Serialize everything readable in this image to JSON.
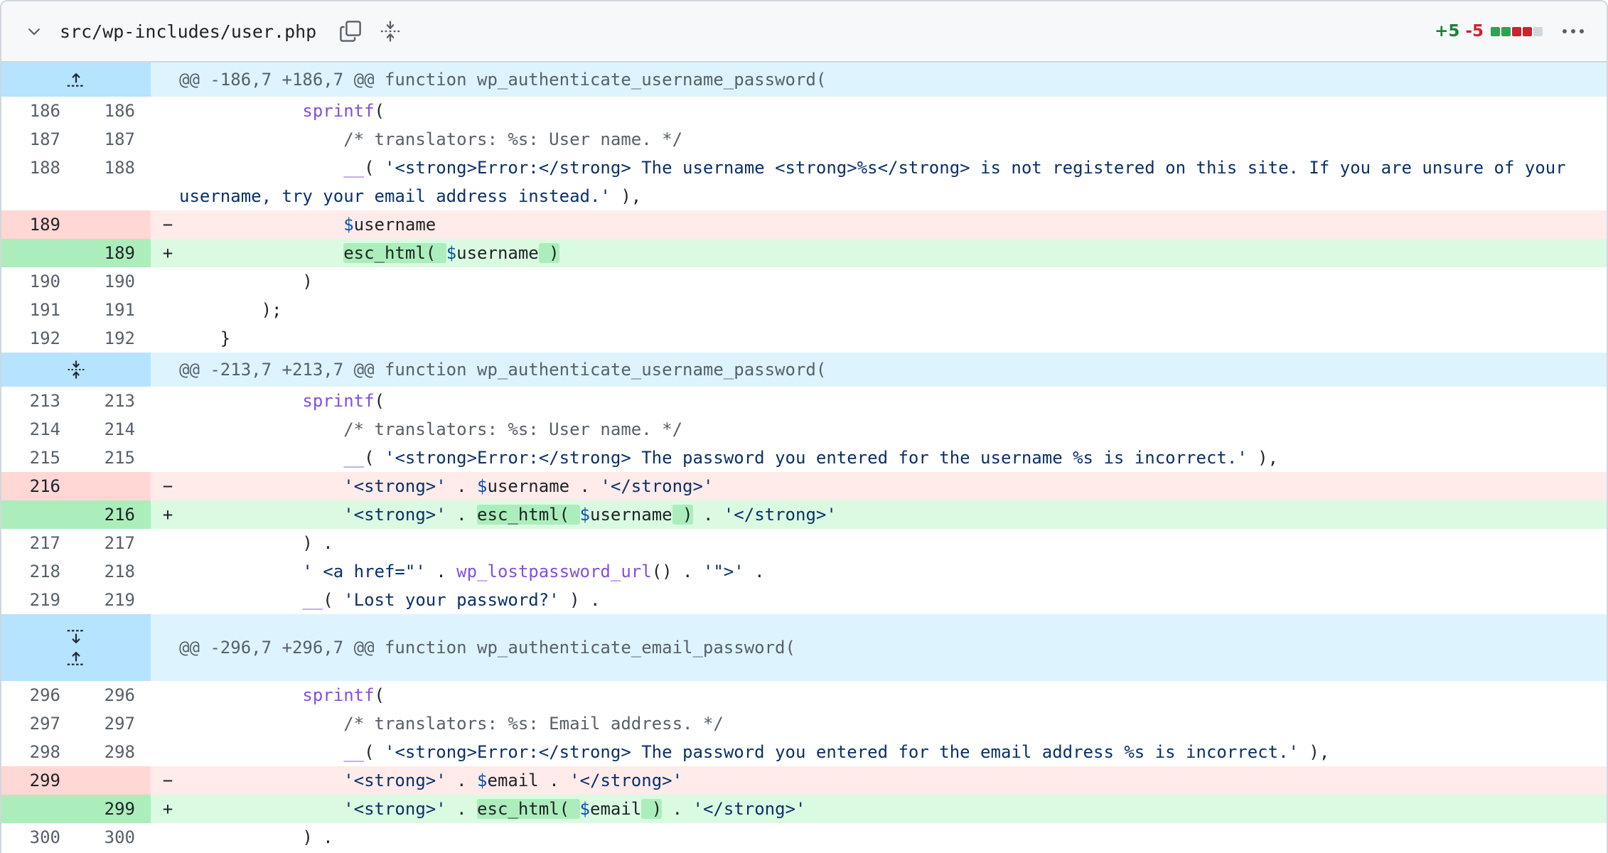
{
  "file": {
    "path": "src/wp-includes/user.php",
    "additions": "+5",
    "deletions": "-5",
    "stat_blocks": [
      "green",
      "green",
      "red",
      "red",
      "neutral"
    ],
    "icons": {
      "collapse": "chevron-down-icon",
      "copy": "copy-icon",
      "expand_all": "unfold-icon",
      "more": "kebab-horizontal-icon"
    },
    "colors": {
      "addition": "#1a7f37",
      "deletion": "#cf222e",
      "hunk_bg": "#ddf4ff",
      "hunk_gutter": "#b6e3ff",
      "add_bg": "#dafbe1",
      "add_num_bg": "#aceebb",
      "del_bg": "#ffebe9",
      "del_num_bg": "#ffd7d5"
    }
  },
  "hunks": [
    {
      "header": "@@ -186,7 +186,7 @@ function wp_authenticate_username_password(",
      "expanders": [
        "expand-up"
      ],
      "lines": [
        {
          "type": "ctx",
          "old": "186",
          "new": "186",
          "tokens": [
            {
              "t": "            ",
              "c": ""
            },
            {
              "t": "sprintf",
              "c": "fn"
            },
            {
              "t": "(",
              "c": ""
            }
          ]
        },
        {
          "type": "ctx",
          "old": "187",
          "new": "187",
          "tokens": [
            {
              "t": "                ",
              "c": ""
            },
            {
              "t": "/* translators: %s: User name. */",
              "c": "cm"
            }
          ]
        },
        {
          "type": "ctx",
          "old": "188",
          "new": "188",
          "tokens": [
            {
              "t": "                ",
              "c": ""
            },
            {
              "t": "__",
              "c": "fn"
            },
            {
              "t": "( ",
              "c": ""
            },
            {
              "t": "'<strong>Error:</strong> The username <strong>%s</strong> is not registered on this site. If you are unsure of your username, try your email address instead.'",
              "c": "st"
            },
            {
              "t": " ),",
              "c": ""
            }
          ]
        },
        {
          "type": "del",
          "old": "189",
          "new": "",
          "sign": "−",
          "tokens": [
            {
              "t": "                ",
              "c": ""
            },
            {
              "t": "$",
              "c": "vr"
            },
            {
              "t": "username",
              "c": ""
            }
          ]
        },
        {
          "type": "add",
          "old": "",
          "new": "189",
          "sign": "+",
          "tokens": [
            {
              "t": "                ",
              "c": ""
            },
            {
              "t": "esc_html( ",
              "c": "hl"
            },
            {
              "t": "$",
              "c": "vr"
            },
            {
              "t": "username",
              "c": ""
            },
            {
              "t": " )",
              "c": "hl"
            }
          ]
        },
        {
          "type": "ctx",
          "old": "190",
          "new": "190",
          "tokens": [
            {
              "t": "            )",
              "c": ""
            }
          ]
        },
        {
          "type": "ctx",
          "old": "191",
          "new": "191",
          "tokens": [
            {
              "t": "        );",
              "c": ""
            }
          ]
        },
        {
          "type": "ctx",
          "old": "192",
          "new": "192",
          "tokens": [
            {
              "t": "    }",
              "c": ""
            }
          ]
        }
      ]
    },
    {
      "header": "@@ -213,7 +213,7 @@ function wp_authenticate_username_password(",
      "expanders": [
        "expand-both"
      ],
      "lines": [
        {
          "type": "ctx",
          "old": "213",
          "new": "213",
          "tokens": [
            {
              "t": "            ",
              "c": ""
            },
            {
              "t": "sprintf",
              "c": "fn"
            },
            {
              "t": "(",
              "c": ""
            }
          ]
        },
        {
          "type": "ctx",
          "old": "214",
          "new": "214",
          "tokens": [
            {
              "t": "                ",
              "c": ""
            },
            {
              "t": "/* translators: %s: User name. */",
              "c": "cm"
            }
          ]
        },
        {
          "type": "ctx",
          "old": "215",
          "new": "215",
          "tokens": [
            {
              "t": "                ",
              "c": ""
            },
            {
              "t": "__",
              "c": "fn"
            },
            {
              "t": "( ",
              "c": ""
            },
            {
              "t": "'<strong>Error:</strong> The password you entered for the username %s is incorrect.'",
              "c": "st"
            },
            {
              "t": " ),",
              "c": ""
            }
          ]
        },
        {
          "type": "del",
          "old": "216",
          "new": "",
          "sign": "−",
          "tokens": [
            {
              "t": "                ",
              "c": ""
            },
            {
              "t": "'<strong>'",
              "c": "st"
            },
            {
              "t": " . ",
              "c": ""
            },
            {
              "t": "$",
              "c": "vr"
            },
            {
              "t": "username",
              "c": ""
            },
            {
              "t": " . ",
              "c": ""
            },
            {
              "t": "'</strong>'",
              "c": "st"
            }
          ]
        },
        {
          "type": "add",
          "old": "",
          "new": "216",
          "sign": "+",
          "tokens": [
            {
              "t": "                ",
              "c": ""
            },
            {
              "t": "'<strong>'",
              "c": "st"
            },
            {
              "t": " . ",
              "c": ""
            },
            {
              "t": "esc_html( ",
              "c": "hl"
            },
            {
              "t": "$",
              "c": "vr"
            },
            {
              "t": "username",
              "c": ""
            },
            {
              "t": " )",
              "c": "hl"
            },
            {
              "t": " . ",
              "c": ""
            },
            {
              "t": "'</strong>'",
              "c": "st"
            }
          ]
        },
        {
          "type": "ctx",
          "old": "217",
          "new": "217",
          "tokens": [
            {
              "t": "            ) .",
              "c": ""
            }
          ]
        },
        {
          "type": "ctx",
          "old": "218",
          "new": "218",
          "tokens": [
            {
              "t": "            ",
              "c": ""
            },
            {
              "t": "' <a href=\"'",
              "c": "st"
            },
            {
              "t": " . ",
              "c": ""
            },
            {
              "t": "wp_lostpassword_url",
              "c": "fn"
            },
            {
              "t": "() . ",
              "c": ""
            },
            {
              "t": "'\">'",
              "c": "st"
            },
            {
              "t": " .",
              "c": ""
            }
          ]
        },
        {
          "type": "ctx",
          "old": "219",
          "new": "219",
          "tokens": [
            {
              "t": "            ",
              "c": ""
            },
            {
              "t": "__",
              "c": "fn"
            },
            {
              "t": "( ",
              "c": ""
            },
            {
              "t": "'Lost your password?'",
              "c": "st"
            },
            {
              "t": " ) .",
              "c": ""
            }
          ]
        }
      ]
    },
    {
      "header": "@@ -296,7 +296,7 @@ function wp_authenticate_email_password(",
      "expanders": [
        "expand-down",
        "expand-up"
      ],
      "lines": [
        {
          "type": "ctx",
          "old": "296",
          "new": "296",
          "tokens": [
            {
              "t": "            ",
              "c": ""
            },
            {
              "t": "sprintf",
              "c": "fn"
            },
            {
              "t": "(",
              "c": ""
            }
          ]
        },
        {
          "type": "ctx",
          "old": "297",
          "new": "297",
          "tokens": [
            {
              "t": "                ",
              "c": ""
            },
            {
              "t": "/* translators: %s: Email address. */",
              "c": "cm"
            }
          ]
        },
        {
          "type": "ctx",
          "old": "298",
          "new": "298",
          "tokens": [
            {
              "t": "                ",
              "c": ""
            },
            {
              "t": "__",
              "c": "fn"
            },
            {
              "t": "( ",
              "c": ""
            },
            {
              "t": "'<strong>Error:</strong> The password you entered for the email address %s is incorrect.'",
              "c": "st"
            },
            {
              "t": " ),",
              "c": ""
            }
          ]
        },
        {
          "type": "del",
          "old": "299",
          "new": "",
          "sign": "−",
          "tokens": [
            {
              "t": "                ",
              "c": ""
            },
            {
              "t": "'<strong>'",
              "c": "st"
            },
            {
              "t": " . ",
              "c": ""
            },
            {
              "t": "$",
              "c": "vr"
            },
            {
              "t": "email",
              "c": ""
            },
            {
              "t": " . ",
              "c": ""
            },
            {
              "t": "'</strong>'",
              "c": "st"
            }
          ]
        },
        {
          "type": "add",
          "old": "",
          "new": "299",
          "sign": "+",
          "tokens": [
            {
              "t": "                ",
              "c": ""
            },
            {
              "t": "'<strong>'",
              "c": "st"
            },
            {
              "t": " . ",
              "c": ""
            },
            {
              "t": "esc_html( ",
              "c": "hl"
            },
            {
              "t": "$",
              "c": "vr"
            },
            {
              "t": "email",
              "c": ""
            },
            {
              "t": " )",
              "c": "hl"
            },
            {
              "t": " . ",
              "c": ""
            },
            {
              "t": "'</strong>'",
              "c": "st"
            }
          ]
        },
        {
          "type": "ctx",
          "old": "300",
          "new": "300",
          "tokens": [
            {
              "t": "            ) .",
              "c": ""
            }
          ]
        }
      ]
    }
  ]
}
